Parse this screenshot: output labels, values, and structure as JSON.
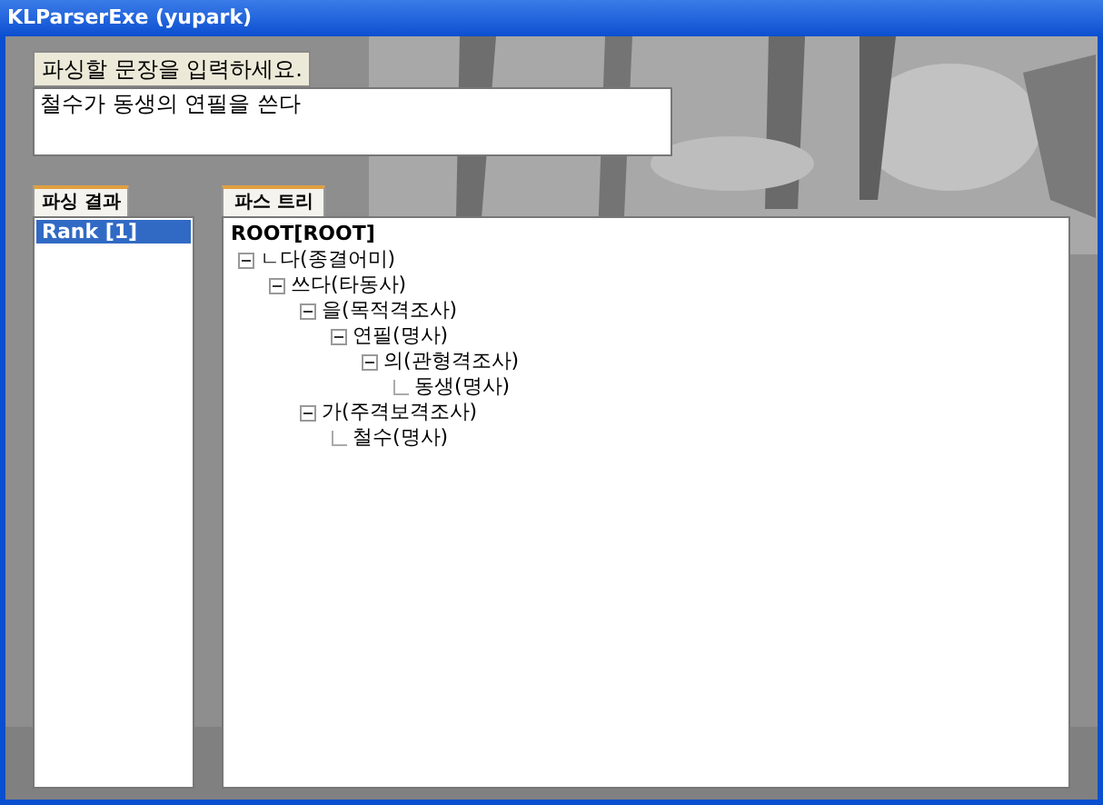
{
  "window": {
    "title": "KLParserExe (yupark)"
  },
  "prompt_label": "파싱할 문장을 입력하세요.",
  "input": {
    "value": "철수가 동생의 연필을 쓴다"
  },
  "results_panel": {
    "tab": "파싱 결과",
    "items": [
      {
        "label": "Rank [1]",
        "selected": true
      }
    ]
  },
  "tree_panel": {
    "tab": "파스 트리",
    "root": "ROOT[ROOT]",
    "nodes": [
      {
        "label": "ㄴ다(종결어미)",
        "expanded": true,
        "children": [
          {
            "label": "쓰다(타동사)",
            "expanded": true,
            "children": [
              {
                "label": "을(목적격조사)",
                "expanded": true,
                "children": [
                  {
                    "label": "연필(명사)",
                    "expanded": true,
                    "children": [
                      {
                        "label": "의(관형격조사)",
                        "expanded": true,
                        "children": [
                          {
                            "label": "동생(명사)"
                          }
                        ]
                      }
                    ]
                  }
                ]
              },
              {
                "label": "가(주격보격조사)",
                "expanded": true,
                "children": [
                  {
                    "label": "철수(명사)"
                  }
                ]
              }
            ]
          }
        ]
      }
    ]
  }
}
